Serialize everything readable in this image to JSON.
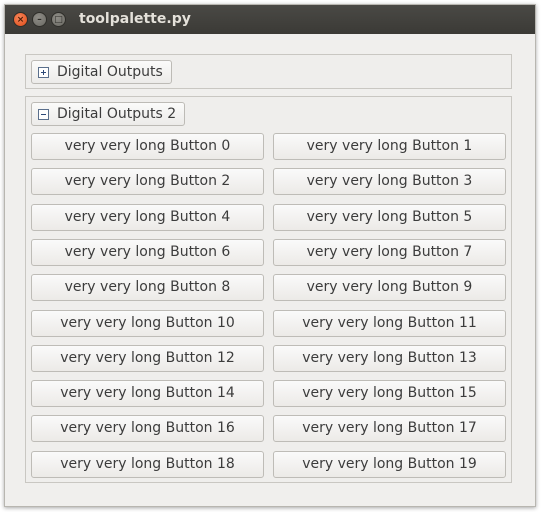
{
  "window": {
    "title": "toolpalette.py"
  },
  "titlebar": {
    "close_glyph": "×",
    "min_glyph": "–",
    "max_glyph": "□"
  },
  "groups": [
    {
      "label": "Digital Outputs",
      "expanded": false,
      "expander_icon": "plus-icon"
    },
    {
      "label": "Digital Outputs 2",
      "expanded": true,
      "expander_icon": "minus-icon"
    }
  ],
  "buttons": [
    "very very long Button 0",
    "very very long Button 1",
    "very very long Button 2",
    "very very long Button 3",
    "very very long Button 4",
    "very very long Button 5",
    "very very long Button 6",
    "very very long Button 7",
    "very very long Button 8",
    "very very long Button 9",
    "very very long Button 10",
    "very very long Button 11",
    "very very long Button 12",
    "very very long Button 13",
    "very very long Button 14",
    "very very long Button 15",
    "very very long Button 16",
    "very very long Button 17",
    "very very long Button 18",
    "very very long Button 19"
  ]
}
